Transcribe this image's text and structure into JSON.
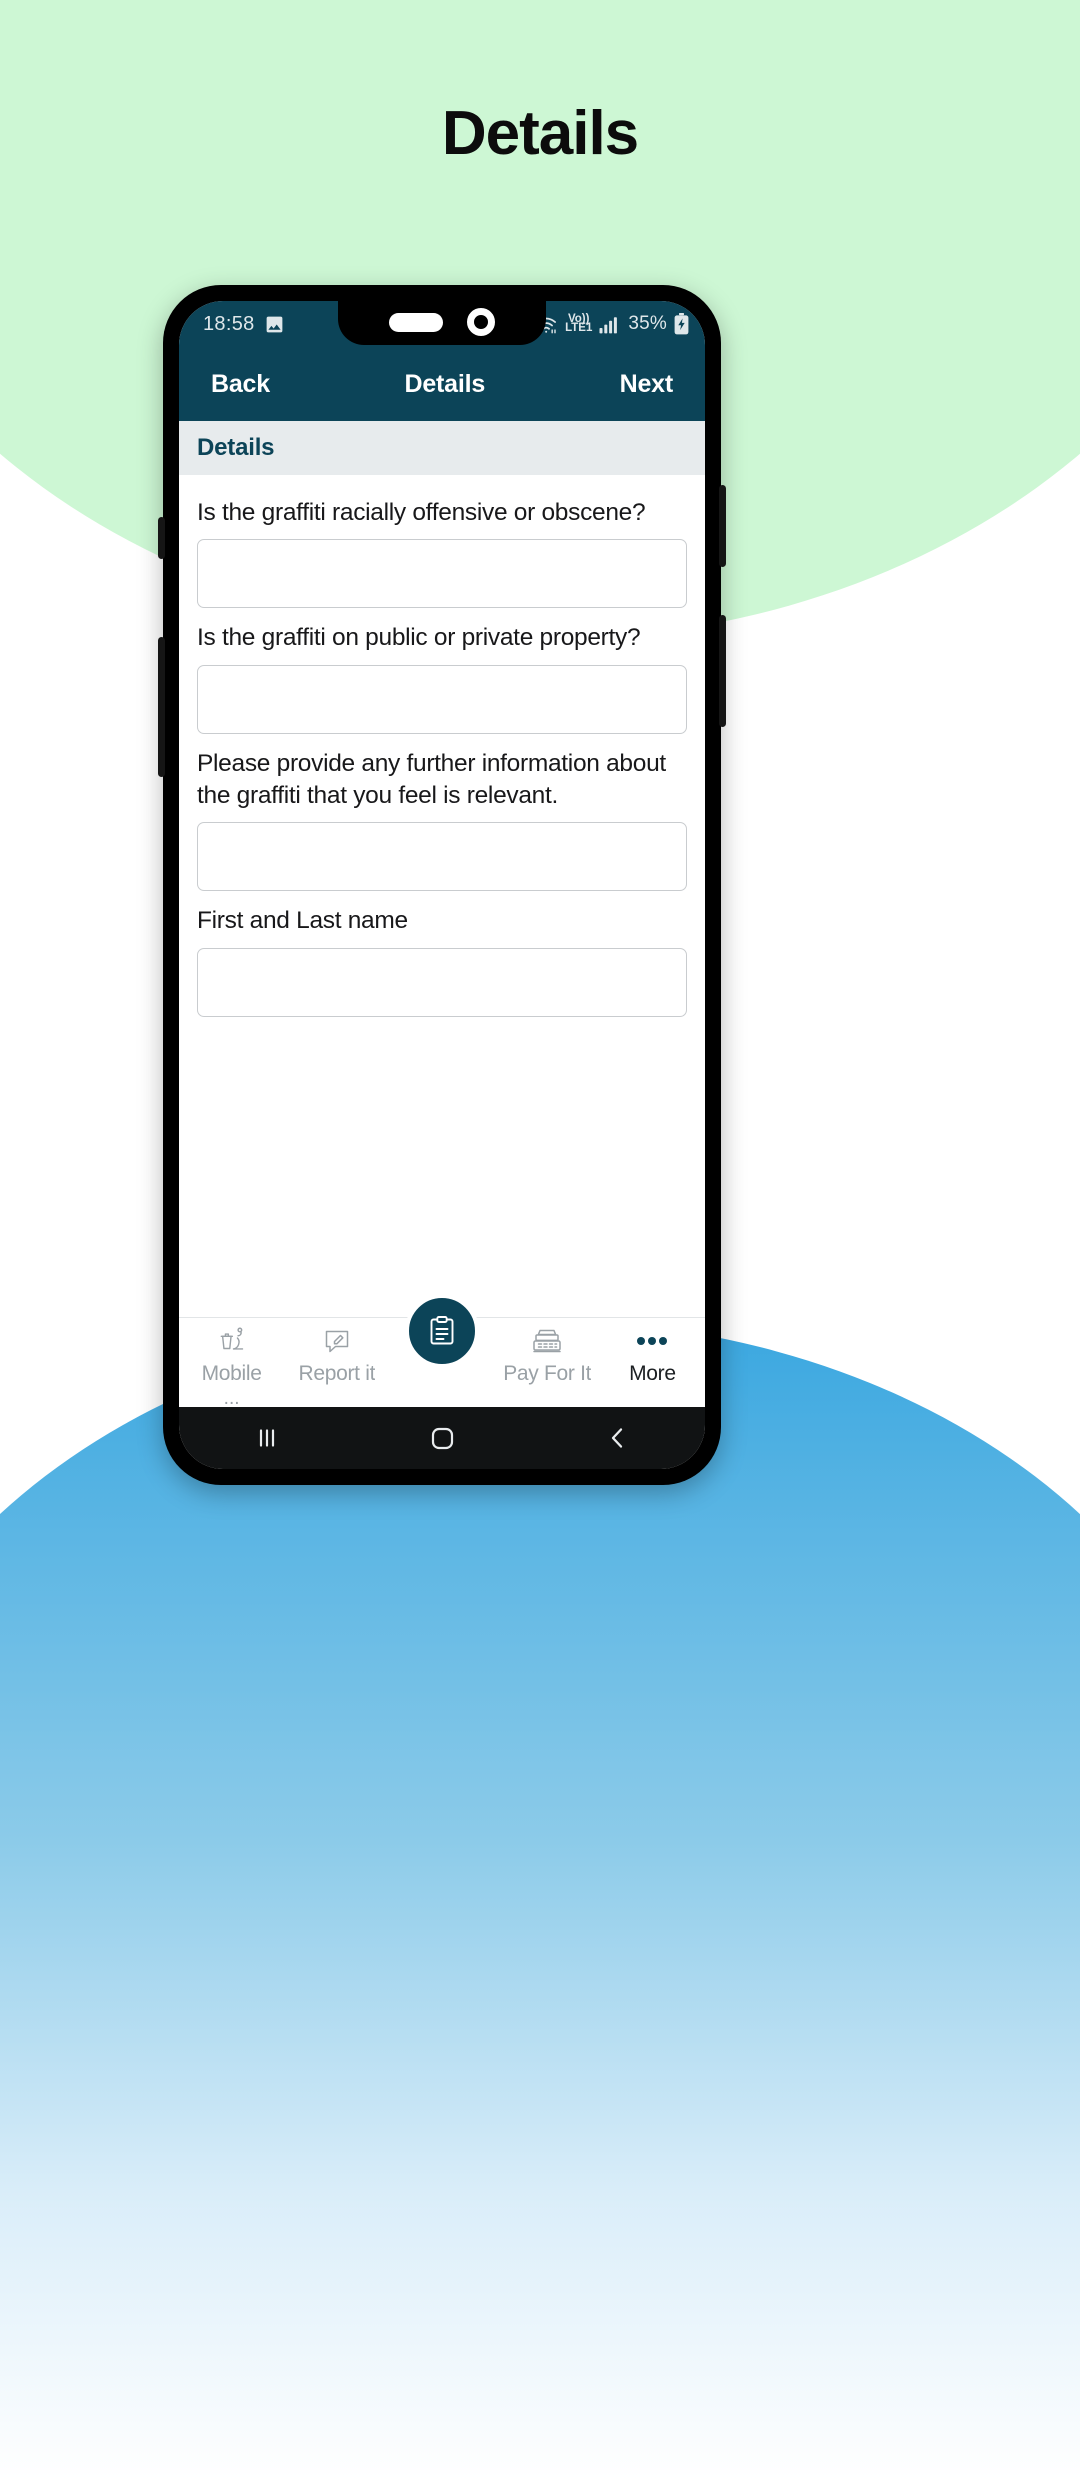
{
  "page": {
    "title": "Details"
  },
  "status_bar": {
    "time": "18:58",
    "photo_icon": "image-icon",
    "alarm_icon": "alarm-icon",
    "wifi_icon": "wifi-icon",
    "volte_label_top": "Vo))",
    "volte_label_bottom": "LTE1",
    "signal_icon": "signal-bars-icon",
    "battery_percent": "35%",
    "battery_icon": "battery-charging-icon"
  },
  "nav_bar": {
    "back_label": "Back",
    "title": "Details",
    "next_label": "Next"
  },
  "section": {
    "header": "Details"
  },
  "form": {
    "fields": [
      {
        "label": "Is the graffiti racially offensive or obscene?",
        "value": "",
        "placeholder": ""
      },
      {
        "label": "Is the graffiti on public or private property?",
        "value": "",
        "placeholder": ""
      },
      {
        "label": "Please provide any further information about the graffiti that you feel is relevant.",
        "value": "",
        "placeholder": ""
      },
      {
        "label": "First and Last name",
        "value": "",
        "placeholder": ""
      }
    ]
  },
  "tab_bar": {
    "items": [
      {
        "label": "Mobile",
        "sublabel": "...",
        "icon": "litter-bin-icon",
        "active": false
      },
      {
        "label": "Report it",
        "icon": "report-pencil-icon",
        "active": false
      },
      {
        "label": "",
        "icon": "clipboard-icon",
        "active": true,
        "is_center": true
      },
      {
        "label": "Pay For It",
        "icon": "cash-register-icon",
        "active": false
      },
      {
        "label": "More",
        "icon": "ellipsis-icon",
        "active": true
      }
    ]
  },
  "system_nav": {
    "recents": "recents-icon",
    "home": "home-icon",
    "back": "back-chevron-icon"
  },
  "colors": {
    "brand_dark": "#0c4458",
    "top_background": "#cdf7d4",
    "bottom_background": "#3aa7e0",
    "section_header_bg": "#e7ebed",
    "input_border": "#c9cccf"
  }
}
